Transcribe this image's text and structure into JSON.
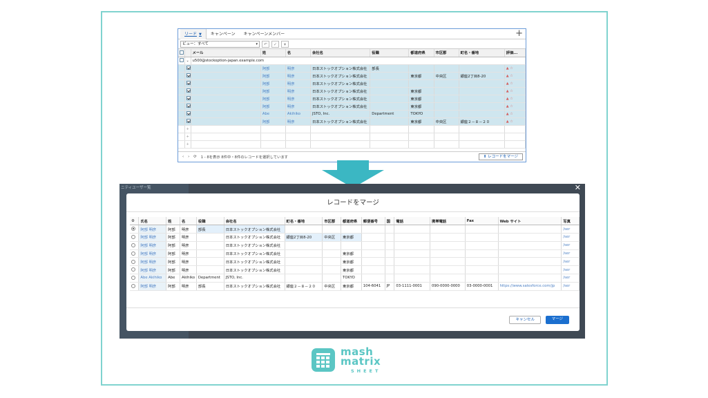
{
  "top_window": {
    "tabs": [
      {
        "label": "リード",
        "active": true
      },
      {
        "label": "キャンペーン",
        "active": false
      },
      {
        "label": "キャンペーンメンバー",
        "active": false
      }
    ],
    "view_select": "ビュー：すべて",
    "columns": [
      "メール",
      "姓",
      "名",
      "会社名",
      "役職",
      "都道府県",
      "市区郡",
      "町名・番地",
      "評価..."
    ],
    "group_label": "u500@stockoption-japan.example.com",
    "rows": [
      {
        "sei": "阿部",
        "mei": "明彦",
        "company": "日本ストックオプション株式会社",
        "title": "部長",
        "pref": "",
        "city": "",
        "street": ""
      },
      {
        "sei": "阿部",
        "mei": "明彦",
        "company": "日本ストックオプション株式会社",
        "title": "",
        "pref": "東京都",
        "city": "中央区",
        "street": "銀座2丁目8-20"
      },
      {
        "sei": "阿部",
        "mei": "明彦",
        "company": "日本ストックオプション株式会社",
        "title": "",
        "pref": "",
        "city": "",
        "street": ""
      },
      {
        "sei": "阿部",
        "mei": "明彦",
        "company": "日本ストックオプション株式会社",
        "title": "",
        "pref": "東京都",
        "city": "",
        "street": ""
      },
      {
        "sei": "阿部",
        "mei": "明彦",
        "company": "日本ストックオプション株式会社",
        "title": "",
        "pref": "東京都",
        "city": "",
        "street": ""
      },
      {
        "sei": "阿部",
        "mei": "明彦",
        "company": "日本ストックオプション株式会社",
        "title": "",
        "pref": "東京都",
        "city": "",
        "street": ""
      },
      {
        "sei": "Abe",
        "mei": "Akihiko",
        "company": "JSTO, Inc.",
        "title": "Department",
        "pref": "TOKYO",
        "city": "",
        "street": ""
      },
      {
        "sei": "阿部",
        "mei": "明彦",
        "company": "日本ストックオプション株式会社",
        "title": "",
        "pref": "東京都",
        "city": "中央区",
        "street": "銀座２－８－２０"
      }
    ],
    "footer_text": "1 - 8を表示 8件中・8件のレコードを選択しています",
    "merge_button": "レコードをマージ"
  },
  "modal": {
    "title": "レコードをマージ",
    "columns": [
      "氏名",
      "姓",
      "名",
      "役職",
      "会社名",
      "町名・番地",
      "市区郡",
      "都道府県",
      "郵便番号",
      "国",
      "電話",
      "携帯電話",
      "Fax",
      "Web サイト",
      "写真"
    ],
    "rows": [
      {
        "selected": true,
        "cells": [
          "阿部 明彦",
          "阿部",
          "明彦",
          "部長",
          "日本ストックオプション株式会社",
          "",
          "",
          "",
          "",
          "",
          "",
          "",
          "",
          "",
          "/ser"
        ]
      },
      {
        "selected": false,
        "cells": [
          "阿部 明彦",
          "阿部",
          "明彦",
          "",
          "日本ストックオプション株式会社",
          "銀座2丁目8-20",
          "中央区",
          "東京都",
          "",
          "",
          "",
          "",
          "",
          "",
          "/ser"
        ]
      },
      {
        "selected": false,
        "cells": [
          "阿部 明彦",
          "阿部",
          "明彦",
          "",
          "日本ストックオプション株式会社",
          "",
          "",
          "",
          "",
          "",
          "",
          "",
          "",
          "",
          "/ser"
        ]
      },
      {
        "selected": false,
        "cells": [
          "阿部 明彦",
          "阿部",
          "明彦",
          "",
          "日本ストックオプション株式会社",
          "",
          "",
          "東京都",
          "",
          "",
          "",
          "",
          "",
          "",
          "/ser"
        ]
      },
      {
        "selected": false,
        "cells": [
          "阿部 明彦",
          "阿部",
          "明彦",
          "",
          "日本ストックオプション株式会社",
          "",
          "",
          "東京都",
          "",
          "",
          "",
          "",
          "",
          "",
          "/ser"
        ]
      },
      {
        "selected": false,
        "cells": [
          "阿部 明彦",
          "阿部",
          "明彦",
          "",
          "日本ストックオプション株式会社",
          "",
          "",
          "東京都",
          "",
          "",
          "",
          "",
          "",
          "",
          "/ser"
        ]
      },
      {
        "selected": false,
        "cells": [
          "Abe Akihiko",
          "Abe",
          "Akihiko",
          "Department",
          "JSTO, Inc.",
          "",
          "",
          "TOKYO",
          "",
          "",
          "",
          "",
          "",
          "",
          "/ser"
        ]
      },
      {
        "selected": false,
        "cells": [
          "阿部 明彦",
          "阿部",
          "明彦",
          "部長",
          "日本ストックオプション株式会社",
          "銀座２－８－２０",
          "中央区",
          "東京都",
          "104-6041",
          "JP",
          "03-1111-0001",
          "090-0000-0000",
          "03-0000-0001",
          "https://www.salesforce.com/jp",
          "/ser"
        ]
      }
    ],
    "cancel_label": "キャンセル",
    "merge_label": "マージ",
    "bg_sidebar": [
      "ニティユーザー覧"
    ]
  },
  "logo": {
    "line1": "mash",
    "line2": "matrix",
    "sub": "SHEET"
  },
  "colors": {
    "frame": "#7fd3cf",
    "accent": "#3bb7c3",
    "brand": "#5bc6c4",
    "selected_row": "#cfe6ef"
  }
}
